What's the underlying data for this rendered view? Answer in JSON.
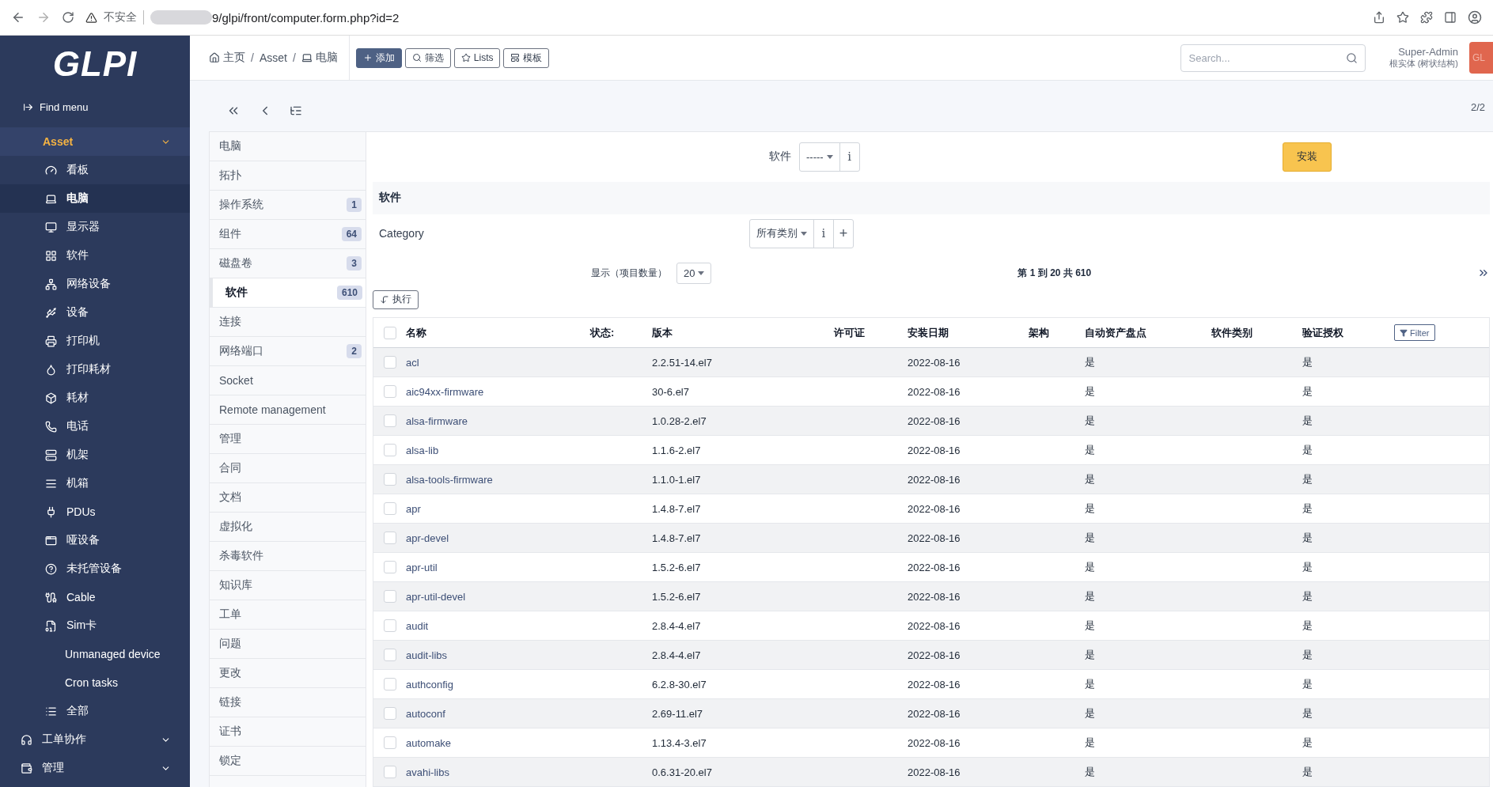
{
  "browser": {
    "security": "不安全",
    "url": "9/glpi/front/computer.form.php?id=2"
  },
  "sidebar": {
    "logo": "GLPI",
    "find_menu": "Find menu",
    "sections": [
      {
        "label": "Asset",
        "expanded": true,
        "items": [
          {
            "label": "看板",
            "selected": false
          },
          {
            "label": "电脑",
            "selected": true
          },
          {
            "label": "显示器",
            "selected": false
          },
          {
            "label": "软件",
            "selected": false
          },
          {
            "label": "网络设备",
            "selected": false
          },
          {
            "label": "设备",
            "selected": false
          },
          {
            "label": "打印机",
            "selected": false
          },
          {
            "label": "打印耗材",
            "selected": false
          },
          {
            "label": "耗材",
            "selected": false
          },
          {
            "label": "电话",
            "selected": false
          },
          {
            "label": "机架",
            "selected": false
          },
          {
            "label": "机箱",
            "selected": false
          },
          {
            "label": "PDUs",
            "selected": false
          },
          {
            "label": "哑设备",
            "selected": false
          },
          {
            "label": "未托管设备",
            "selected": false
          },
          {
            "label": "Cable",
            "selected": false
          },
          {
            "label": "Sim卡",
            "selected": false
          },
          {
            "label": "Unmanaged device",
            "selected": false
          },
          {
            "label": "Cron tasks",
            "selected": false
          },
          {
            "label": "全部",
            "selected": false
          }
        ]
      },
      {
        "label": "工单协作",
        "expanded": false
      },
      {
        "label": "管理",
        "expanded": false
      }
    ]
  },
  "header": {
    "breadcrumb": [
      "主页",
      "Asset",
      "电脑"
    ],
    "separators": [
      "/",
      "/"
    ],
    "actions": [
      {
        "label": "添加",
        "kind": "primary"
      },
      {
        "label": "筛选",
        "kind": "outline"
      },
      {
        "label": "Lists",
        "kind": "outline"
      },
      {
        "label": "模板",
        "kind": "outline"
      }
    ],
    "search": {
      "placeholder": "Search..."
    },
    "user": "Super-Admin",
    "entity": "根实体 (树状结构)",
    "profile_badge": "GL"
  },
  "pager": "2/2",
  "tabs": [
    {
      "label": "电脑",
      "selected": false
    },
    {
      "label": "拓扑",
      "selected": false
    },
    {
      "label": "操作系统",
      "count": "1",
      "selected": false
    },
    {
      "label": "组件",
      "count": "64",
      "selected": false
    },
    {
      "label": "磁盘卷",
      "count": "3",
      "selected": false
    },
    {
      "label": "软件",
      "count": "610",
      "selected": true
    },
    {
      "label": "连接",
      "selected": false
    },
    {
      "label": "网络端口",
      "count": "2",
      "selected": false
    },
    {
      "label": "Socket",
      "selected": false
    },
    {
      "label": "Remote management",
      "selected": false
    },
    {
      "label": "管理",
      "selected": false
    },
    {
      "label": "合同",
      "selected": false
    },
    {
      "label": "文档",
      "selected": false
    },
    {
      "label": "虚拟化",
      "selected": false
    },
    {
      "label": "杀毒软件",
      "selected": false
    },
    {
      "label": "知识库",
      "selected": false
    },
    {
      "label": "工单",
      "selected": false
    },
    {
      "label": "问题",
      "selected": false
    },
    {
      "label": "更改",
      "selected": false
    },
    {
      "label": "链接",
      "selected": false
    },
    {
      "label": "证书",
      "selected": false
    },
    {
      "label": "锁定",
      "selected": false
    }
  ],
  "install": {
    "label": "软件",
    "value": "-----",
    "info": "i",
    "button": "安装"
  },
  "section_title": "软件",
  "category": {
    "label": "Category",
    "value": "所有类别",
    "info": "i",
    "add": "+"
  },
  "display": {
    "label": "显示（项目数量）",
    "value": "20",
    "range": "第 1 到 20 共 610"
  },
  "action_button": "执行",
  "table": {
    "columns": [
      "名称",
      "状态:",
      "版本",
      "许可证",
      "安装日期",
      "架构",
      "自动资产盘点",
      "软件类别",
      "验证授权"
    ],
    "filter": "Filter",
    "header_checked": false,
    "rows": [
      {
        "name": "acl",
        "version": "2.2.51-14.el7",
        "date": "2022-08-16",
        "auto": "是",
        "verified": "是",
        "checked": false
      },
      {
        "name": "aic94xx-firmware",
        "version": "30-6.el7",
        "date": "2022-08-16",
        "auto": "是",
        "verified": "是",
        "checked": false
      },
      {
        "name": "alsa-firmware",
        "version": "1.0.28-2.el7",
        "date": "2022-08-16",
        "auto": "是",
        "verified": "是",
        "checked": false
      },
      {
        "name": "alsa-lib",
        "version": "1.1.6-2.el7",
        "date": "2022-08-16",
        "auto": "是",
        "verified": "是",
        "checked": false
      },
      {
        "name": "alsa-tools-firmware",
        "version": "1.1.0-1.el7",
        "date": "2022-08-16",
        "auto": "是",
        "verified": "是",
        "checked": false
      },
      {
        "name": "apr",
        "version": "1.4.8-7.el7",
        "date": "2022-08-16",
        "auto": "是",
        "verified": "是",
        "checked": false
      },
      {
        "name": "apr-devel",
        "version": "1.4.8-7.el7",
        "date": "2022-08-16",
        "auto": "是",
        "verified": "是",
        "checked": false
      },
      {
        "name": "apr-util",
        "version": "1.5.2-6.el7",
        "date": "2022-08-16",
        "auto": "是",
        "verified": "是",
        "checked": false
      },
      {
        "name": "apr-util-devel",
        "version": "1.5.2-6.el7",
        "date": "2022-08-16",
        "auto": "是",
        "verified": "是",
        "checked": false
      },
      {
        "name": "audit",
        "version": "2.8.4-4.el7",
        "date": "2022-08-16",
        "auto": "是",
        "verified": "是",
        "checked": false
      },
      {
        "name": "audit-libs",
        "version": "2.8.4-4.el7",
        "date": "2022-08-16",
        "auto": "是",
        "verified": "是",
        "checked": false
      },
      {
        "name": "authconfig",
        "version": "6.2.8-30.el7",
        "date": "2022-08-16",
        "auto": "是",
        "verified": "是",
        "checked": false
      },
      {
        "name": "autoconf",
        "version": "2.69-11.el7",
        "date": "2022-08-16",
        "auto": "是",
        "verified": "是",
        "checked": false
      },
      {
        "name": "automake",
        "version": "1.13.4-3.el7",
        "date": "2022-08-16",
        "auto": "是",
        "verified": "是",
        "checked": false
      },
      {
        "name": "avahi-libs",
        "version": "0.6.31-20.el7",
        "date": "2022-08-16",
        "auto": "是",
        "verified": "是",
        "checked": false
      }
    ]
  }
}
